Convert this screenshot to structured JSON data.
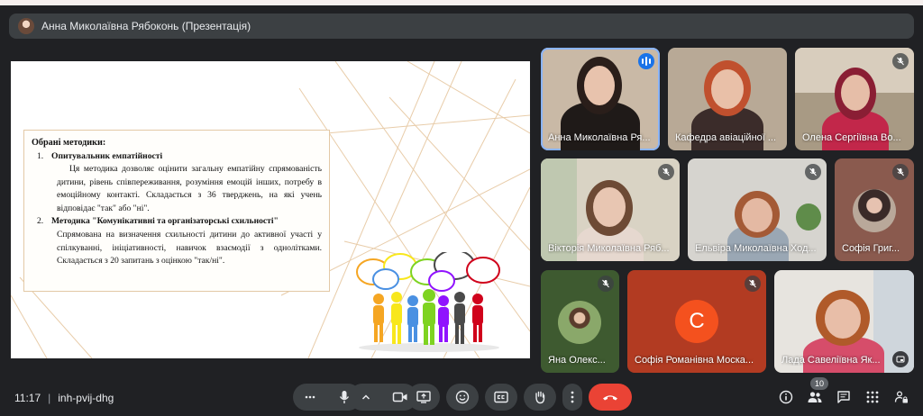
{
  "presenter_bar": {
    "name": "Анна Миколаївна Рябоконь (Презентація)"
  },
  "slide": {
    "heading": "Обрані методики:",
    "methods": [
      {
        "num": "1.",
        "title": "Опитувальник емпатійності",
        "desc": "Ця методика дозволяє оцінити загальну емпатійну спрямованість дитини, рівень співпереживання, розуміння емоцій інших, потребу в емоційному контакті. Складається з 36 тверджень, на які учень відповідає \"так\" або \"ні\"."
      },
      {
        "num": "2.",
        "title": "Методика \"Комунікативні та організаторські схильності\"",
        "desc": "Спрямована на визначення схильності дитини до активної участі у спілкуванні, ініціативності, навичок взаємодії з однолітками. Складається з 20 запитань з оцінкою \"так/ні\"."
      }
    ]
  },
  "participants": [
    {
      "name": "Анна Миколаївна Ря...",
      "mic": "speaking"
    },
    {
      "name": "Кафедра авіаційної ...",
      "mic": "none"
    },
    {
      "name": "Олена Сергіївна Во...",
      "mic": "muted"
    },
    {
      "name": "Вікторія Миколаївна Ряб...",
      "mic": "muted"
    },
    {
      "name": "Ельвіра Миколаївна Ход...",
      "mic": "muted"
    },
    {
      "name": "Софія Григ...",
      "mic": "muted"
    },
    {
      "name": "Яна Олекс...",
      "mic": "muted"
    },
    {
      "name": "Софія Романівна Моска...",
      "mic": "muted",
      "initial": "С"
    },
    {
      "name": "Лада Савеліївна Як...",
      "mic": "none"
    }
  ],
  "bottom_bar": {
    "time": "11:17",
    "separator": "|",
    "meeting_code": "inh-pvij-dhg",
    "people_count": "10"
  },
  "colors": {
    "background": "#202124",
    "control": "#3c4043",
    "hangup": "#ea4335",
    "avatar_orange": "#f4511e",
    "speaking_blue": "#1a73e8"
  }
}
